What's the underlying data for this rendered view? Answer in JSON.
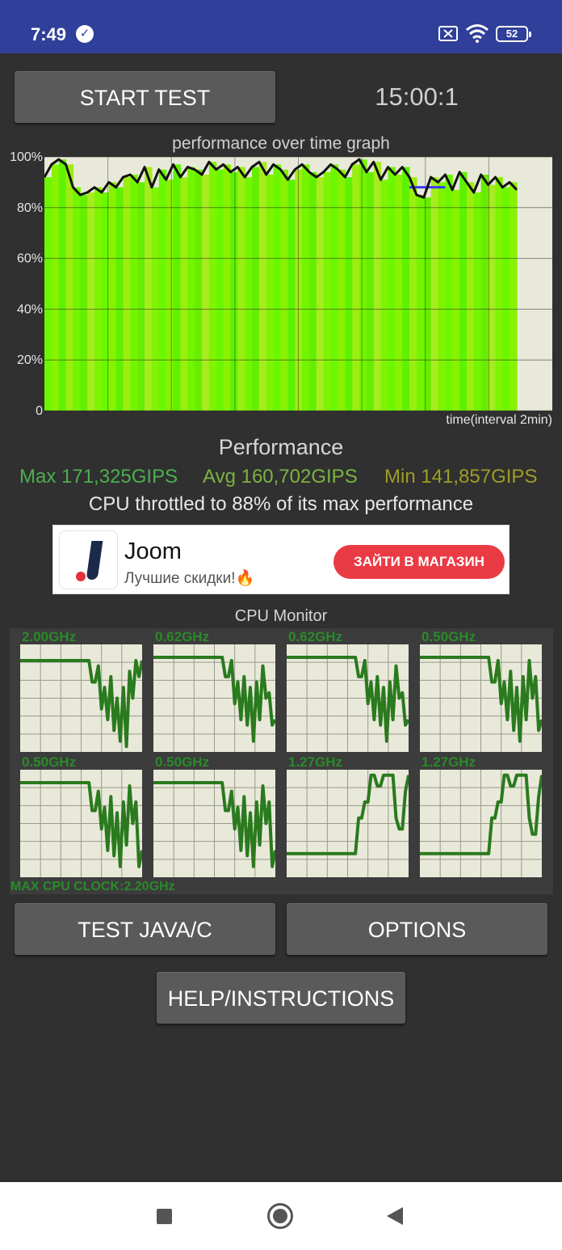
{
  "status_bar": {
    "time": "7:49",
    "battery": "52",
    "icons": [
      "check-circle-icon",
      "sim-off-icon",
      "wifi-icon",
      "battery-icon"
    ]
  },
  "toolbar": {
    "start_label": "START TEST",
    "timer": "15:00:1"
  },
  "graph": {
    "title": "performance over time graph",
    "xlabel": "time(interval 2min)",
    "yticks": [
      "100%",
      "80%",
      "60%",
      "40%",
      "20%",
      "0"
    ]
  },
  "chart_data": {
    "type": "area",
    "title": "performance over time graph",
    "xlabel": "time(interval 2min)",
    "ylabel": "",
    "ylim": [
      0,
      100
    ],
    "grid": true,
    "y": [
      92,
      97,
      99,
      97,
      88,
      85,
      86,
      88,
      86,
      90,
      88,
      92,
      93,
      90,
      96,
      88,
      95,
      91,
      97,
      92,
      96,
      95,
      93,
      98,
      95,
      97,
      94,
      96,
      92,
      96,
      98,
      93,
      97,
      95,
      91,
      95,
      97,
      94,
      92,
      94,
      97,
      95,
      92,
      97,
      99,
      94,
      98,
      91,
      96,
      93,
      96,
      92,
      85,
      84,
      92,
      90,
      93,
      87,
      94,
      90,
      86,
      93,
      89,
      92,
      88,
      90,
      87
    ],
    "reference_line": {
      "y": 88,
      "color": "#3a3aff"
    }
  },
  "performance": {
    "title": "Performance",
    "max": "Max 171,325GIPS",
    "avg": "Avg 160,702GIPS",
    "min": "Min 141,857GIPS",
    "throttle": "CPU throttled to 88% of its max performance"
  },
  "ad": {
    "name": "Joom",
    "subtitle": "Лучшие скидки!🔥",
    "cta": "ЗАЙТИ В МАГАЗИН",
    "logo_icon": "joom-logo-icon"
  },
  "cpu_monitor": {
    "title": "CPU Monitor",
    "cores": [
      {
        "label": "2.00GHz",
        "levels": [
          0.85,
          0.85,
          0.85,
          0.85,
          0.85,
          0.85,
          0.85,
          0.85,
          0.85,
          0.85,
          0.85,
          0.85,
          0.85,
          0.85,
          0.85,
          0.85,
          0.85,
          0.85,
          0.85,
          0.85,
          0.85,
          0.85,
          0.85,
          0.65,
          0.65,
          0.8,
          0.4,
          0.6,
          0.3,
          0.7,
          0.2,
          0.5,
          0.1,
          0.6,
          0.05,
          0.75,
          0.5,
          0.85,
          0.7,
          0.85
        ]
      },
      {
        "label": "0.62GHz",
        "levels": [
          0.88,
          0.88,
          0.88,
          0.88,
          0.88,
          0.88,
          0.88,
          0.88,
          0.88,
          0.88,
          0.88,
          0.88,
          0.88,
          0.88,
          0.88,
          0.88,
          0.88,
          0.88,
          0.88,
          0.88,
          0.88,
          0.88,
          0.88,
          0.7,
          0.7,
          0.85,
          0.45,
          0.65,
          0.3,
          0.7,
          0.25,
          0.6,
          0.1,
          0.65,
          0.3,
          0.8,
          0.5,
          0.55,
          0.25,
          0.3
        ]
      },
      {
        "label": "0.62GHz",
        "levels": [
          0.88,
          0.88,
          0.88,
          0.88,
          0.88,
          0.88,
          0.88,
          0.88,
          0.88,
          0.88,
          0.88,
          0.88,
          0.88,
          0.88,
          0.88,
          0.88,
          0.88,
          0.88,
          0.88,
          0.88,
          0.88,
          0.88,
          0.88,
          0.7,
          0.7,
          0.85,
          0.45,
          0.65,
          0.3,
          0.7,
          0.25,
          0.6,
          0.1,
          0.65,
          0.3,
          0.8,
          0.5,
          0.55,
          0.25,
          0.3
        ]
      },
      {
        "label": "0.50GHz",
        "levels": [
          0.88,
          0.88,
          0.88,
          0.88,
          0.88,
          0.88,
          0.88,
          0.88,
          0.88,
          0.88,
          0.88,
          0.88,
          0.88,
          0.88,
          0.88,
          0.88,
          0.88,
          0.88,
          0.88,
          0.88,
          0.88,
          0.88,
          0.88,
          0.65,
          0.65,
          0.85,
          0.45,
          0.65,
          0.3,
          0.75,
          0.2,
          0.6,
          0.1,
          0.7,
          0.3,
          0.85,
          0.5,
          0.7,
          0.2,
          0.3
        ]
      },
      {
        "label": "0.50GHz",
        "levels": [
          0.88,
          0.88,
          0.88,
          0.88,
          0.88,
          0.88,
          0.88,
          0.88,
          0.88,
          0.88,
          0.88,
          0.88,
          0.88,
          0.88,
          0.88,
          0.88,
          0.88,
          0.88,
          0.88,
          0.88,
          0.88,
          0.88,
          0.88,
          0.62,
          0.62,
          0.8,
          0.45,
          0.65,
          0.25,
          0.75,
          0.2,
          0.6,
          0.1,
          0.7,
          0.3,
          0.85,
          0.5,
          0.7,
          0.1,
          0.25
        ]
      },
      {
        "label": "0.50GHz",
        "levels": [
          0.88,
          0.88,
          0.88,
          0.88,
          0.88,
          0.88,
          0.88,
          0.88,
          0.88,
          0.88,
          0.88,
          0.88,
          0.88,
          0.88,
          0.88,
          0.88,
          0.88,
          0.88,
          0.88,
          0.88,
          0.88,
          0.88,
          0.88,
          0.62,
          0.62,
          0.8,
          0.45,
          0.65,
          0.25,
          0.75,
          0.2,
          0.6,
          0.1,
          0.7,
          0.3,
          0.85,
          0.5,
          0.7,
          0.1,
          0.25
        ]
      },
      {
        "label": "1.27GHz",
        "levels": [
          0.22,
          0.22,
          0.22,
          0.22,
          0.22,
          0.22,
          0.22,
          0.22,
          0.22,
          0.22,
          0.22,
          0.22,
          0.22,
          0.22,
          0.22,
          0.22,
          0.22,
          0.22,
          0.22,
          0.22,
          0.22,
          0.22,
          0.22,
          0.55,
          0.55,
          0.7,
          0.7,
          0.95,
          0.95,
          0.85,
          0.85,
          0.95,
          0.95,
          0.95,
          0.95,
          0.55,
          0.45,
          0.45,
          0.8,
          0.95
        ]
      },
      {
        "label": "1.27GHz",
        "levels": [
          0.22,
          0.22,
          0.22,
          0.22,
          0.22,
          0.22,
          0.22,
          0.22,
          0.22,
          0.22,
          0.22,
          0.22,
          0.22,
          0.22,
          0.22,
          0.22,
          0.22,
          0.22,
          0.22,
          0.22,
          0.22,
          0.22,
          0.22,
          0.55,
          0.55,
          0.7,
          0.7,
          0.95,
          0.95,
          0.85,
          0.85,
          0.95,
          0.95,
          0.95,
          0.95,
          0.55,
          0.4,
          0.4,
          0.75,
          0.95
        ]
      }
    ],
    "max_clock": "MAX CPU CLOCK:2.20GHz"
  },
  "buttons": {
    "test_java": "TEST JAVA/C",
    "options": "OPTIONS",
    "help": "HELP/INSTRUCTIONS"
  },
  "nav": {
    "icons": [
      "recents-square-icon",
      "home-circle-icon",
      "back-triangle-icon"
    ]
  },
  "colors": {
    "status_bar": "#2f3f9a",
    "background": "#303030",
    "button": "#5a5a5a",
    "graph_bg": "#e9e9da",
    "perf_green": "#6cf700",
    "max_color": "#4caf50",
    "avg_color": "#7cb342",
    "min_color": "#9e9d24",
    "cpu_line": "#2a8a2a",
    "ad_cta": "#ea3b45"
  }
}
